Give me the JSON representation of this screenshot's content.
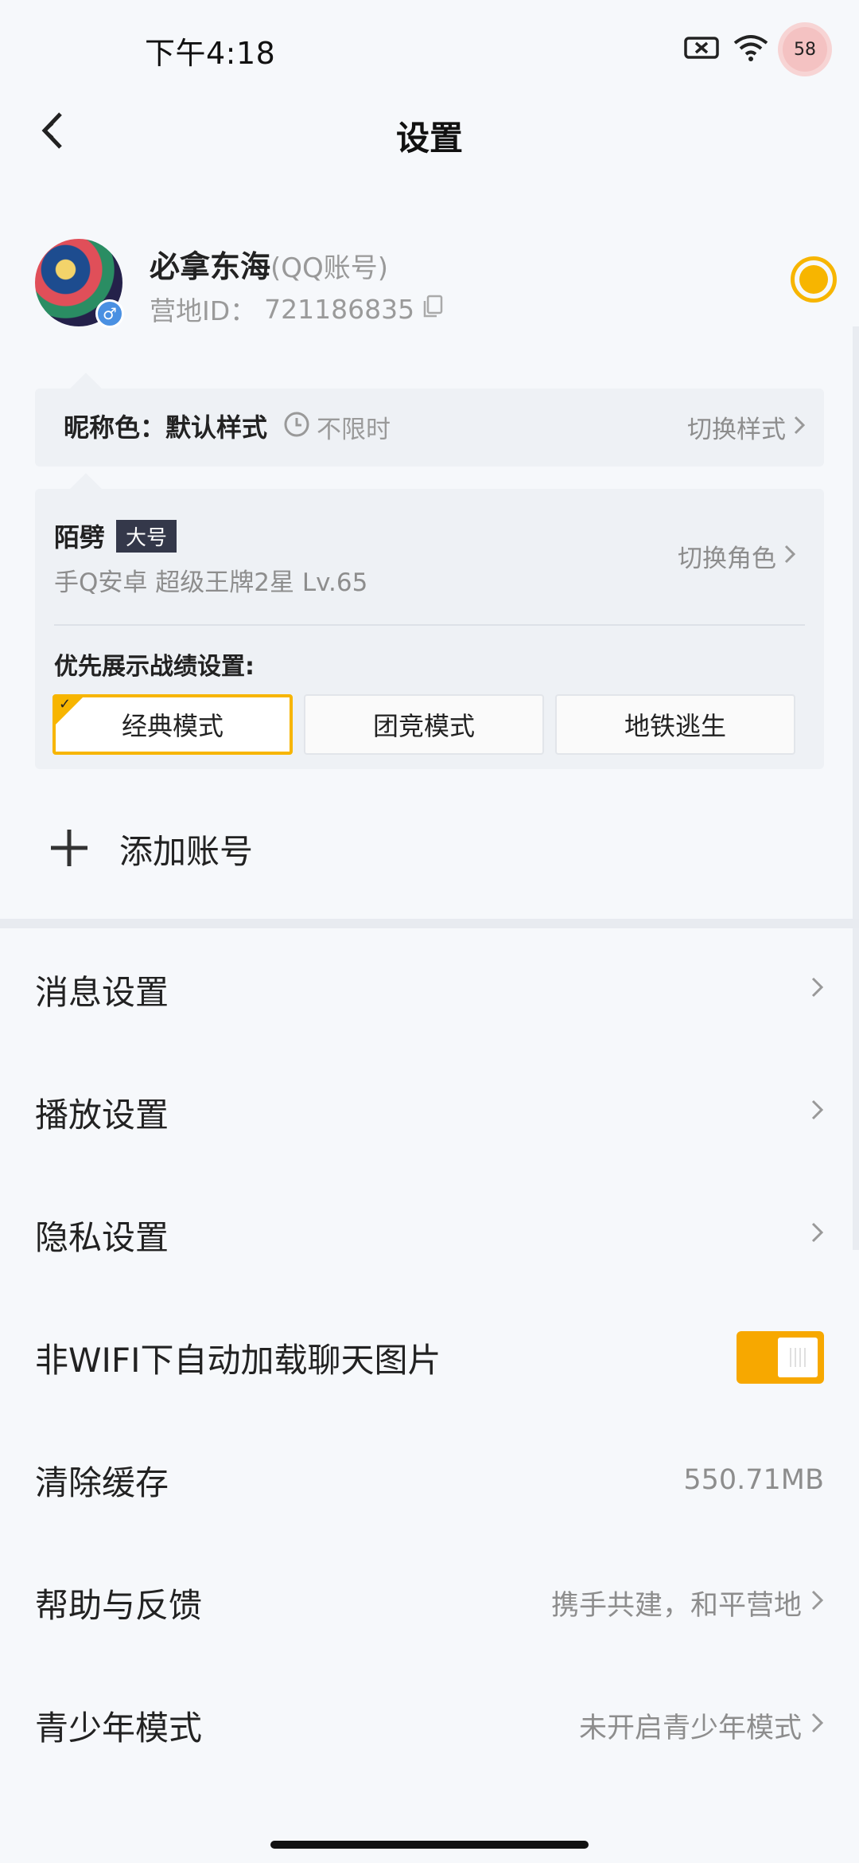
{
  "status_bar": {
    "time": "下午4:18",
    "battery": "58"
  },
  "header": {
    "title": "设置"
  },
  "profile": {
    "name": "必拿东海",
    "account_type": "(QQ账号)",
    "id_label": "营地ID：",
    "id_value": "721186835",
    "gender": "♂"
  },
  "nickname": {
    "label": "昵称色：默认样式",
    "limit": "不限时",
    "switch_label": "切换样式"
  },
  "role": {
    "name": "陌劈",
    "tag": "大号",
    "info": "手Q安卓  超级王牌2星  Lv.65",
    "switch_label": "切换角色",
    "preference_label": "优先展示战绩设置:",
    "modes": [
      "经典模式",
      "团竞模式",
      "地铁逃生"
    ],
    "selected_mode": "经典模式"
  },
  "add_account": {
    "label": "添加账号"
  },
  "settings": {
    "message": {
      "label": "消息设置"
    },
    "playback": {
      "label": "播放设置"
    },
    "privacy": {
      "label": "隐私设置"
    },
    "wifi_images": {
      "label": "非WIFI下自动加载聊天图片",
      "enabled": true
    },
    "cache": {
      "label": "清除缓存",
      "value": "550.71MB"
    },
    "help": {
      "label": "帮助与反馈",
      "value": "携手共建，和平营地"
    },
    "youth": {
      "label": "青少年模式",
      "value": "未开启青少年模式"
    }
  },
  "colors": {
    "accent": "#f7b500",
    "toggle": "#f7a800",
    "background": "#f6f8fb"
  }
}
